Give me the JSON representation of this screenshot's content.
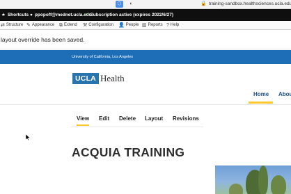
{
  "browser": {
    "url": "training-sandbox.healthsciences.ucla.edu"
  },
  "admin_bar": {
    "shortcuts_label": "Shortcuts",
    "user_label": "ppopoff@mednet.ucla.edu",
    "subscription_label": "Subscription active (expires 2022/6/27)"
  },
  "admin_tray": {
    "items": [
      {
        "label": "Structure",
        "icon": "structure-icon"
      },
      {
        "label": "Appearance",
        "icon": "appearance-icon"
      },
      {
        "label": "Extend",
        "icon": "extend-icon"
      },
      {
        "label": "Configuration",
        "icon": "configuration-icon"
      },
      {
        "label": "People",
        "icon": "people-icon"
      },
      {
        "label": "Reports",
        "icon": "reports-icon"
      },
      {
        "label": "Help",
        "icon": "help-icon"
      }
    ]
  },
  "message": {
    "text": "layout override has been saved."
  },
  "uc_strip": {
    "text": "University of California, Los Angeles"
  },
  "logo": {
    "ucla": "UCLA",
    "health": "Health"
  },
  "main_nav": {
    "home": "Home",
    "about": "Abou"
  },
  "tabs": [
    {
      "label": "View",
      "active": true
    },
    {
      "label": "Edit",
      "active": false
    },
    {
      "label": "Delete",
      "active": false
    },
    {
      "label": "Layout",
      "active": false
    },
    {
      "label": "Revisions",
      "active": false
    }
  ],
  "page": {
    "title": "ACQUIA TRAINING"
  },
  "colors": {
    "ucla_blue": "#2774ae",
    "strip_blue": "#1e6db7",
    "ucla_gold": "#ffc72c",
    "admin_black": "#0f0f0f"
  }
}
